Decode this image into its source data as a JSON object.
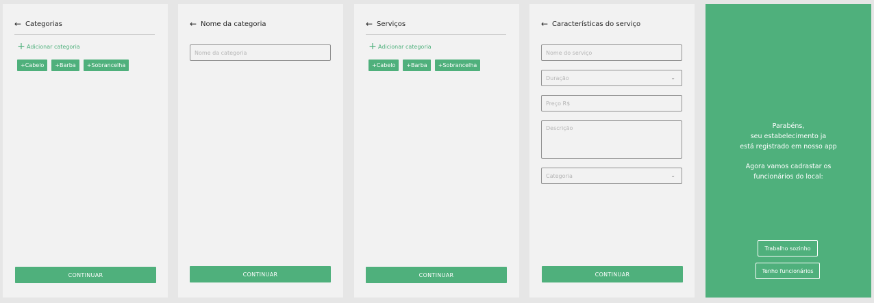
{
  "screen1": {
    "title": "Categorias",
    "add_label": "Adicionar categoria",
    "chips": [
      "+Cabelo",
      "+Barba",
      "+Sobrancelha"
    ],
    "continue_label": "CONTINUAR"
  },
  "screen2": {
    "title": "Nome da categoria",
    "name_placeholder": "Nome da categoria",
    "continue_label": "CONTINUAR"
  },
  "screen3": {
    "title": "Serviços",
    "add_label": "Adicionar categoria",
    "chips": [
      "+Cabelo",
      "+Barba",
      "+Sobrancelha"
    ],
    "continue_label": "CONTINUAR"
  },
  "screen4": {
    "title": "Características do serviço",
    "service_name_placeholder": "Nome do serviço",
    "duration_placeholder": "Duração",
    "price_placeholder": "Preço R$",
    "description_placeholder": "Descrição",
    "category_placeholder": "Categoria",
    "continue_label": "CONTINUAR"
  },
  "screen5": {
    "congrats_line1": "Parabéns,",
    "congrats_line2": "seu estabelecimento ja",
    "congrats_line3": "está registrado em nosso app",
    "next_line1": "Agora vamos cadrastar os",
    "next_line2": "funcionários do local:",
    "work_alone_label": "Trabalho sozinho",
    "have_staff_label": "Tenho funcionários"
  },
  "colors": {
    "accent": "#4fb07c",
    "panel_bg": "#f2f2f2",
    "page_bg": "#e6e6e6"
  },
  "icons": {
    "back": "arrow-left-icon",
    "add": "plus-icon",
    "dropdown": "chevron-down-icon"
  }
}
